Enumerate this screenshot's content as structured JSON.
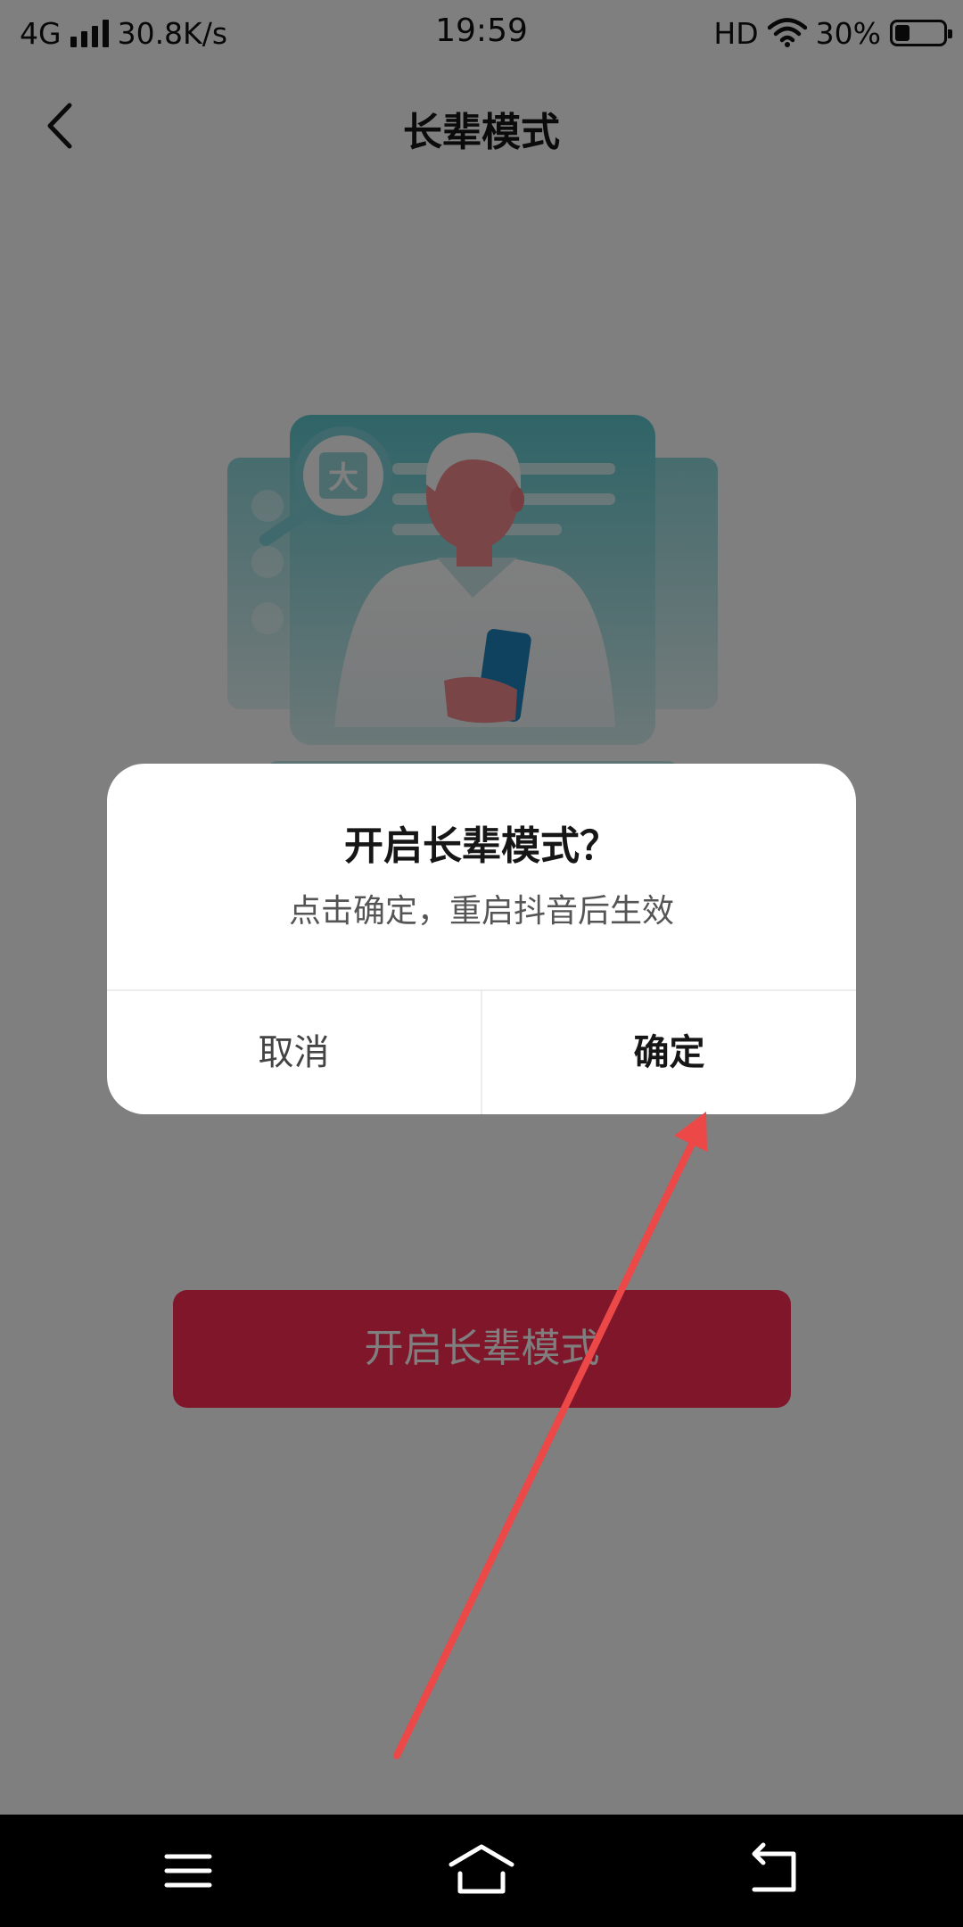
{
  "status_bar": {
    "network": "4G",
    "speed": "30.8K/s",
    "time": "19:59",
    "hd": "HD",
    "battery": "30%",
    "battery_level": 0.3
  },
  "header": {
    "title": "长辈模式",
    "back_icon": "chevron-left-icon"
  },
  "illustration": {
    "magnifier_text": "大"
  },
  "main": {
    "enable_button_label": "开启长辈模式"
  },
  "dialog": {
    "title": "开启长辈模式？",
    "message": "点击确定，重启抖音后生效",
    "cancel_label": "取消",
    "confirm_label": "确定"
  },
  "nav_bar": {
    "icons": [
      "menu-icon",
      "home-icon",
      "back-icon"
    ]
  },
  "colors": {
    "accent": "#fe2c55",
    "annotation_arrow": "#ec4848",
    "overlay": "rgba(0,0,0,0.5)"
  }
}
